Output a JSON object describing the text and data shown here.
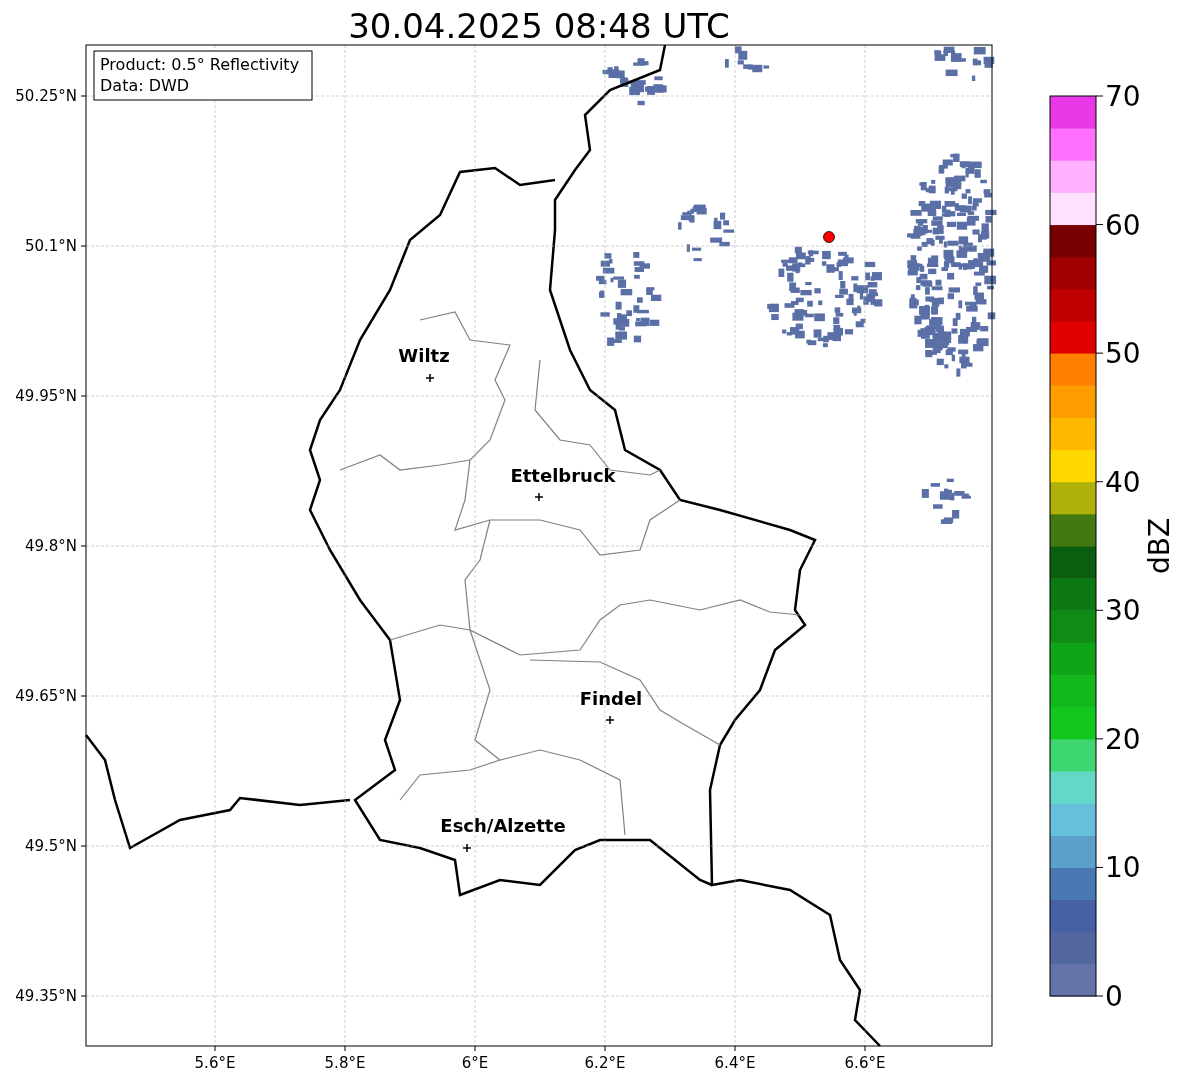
{
  "title": "30.04.2025 08:48 UTC",
  "info_box": [
    "Product: 0.5° Reflectivity",
    "Data: DWD"
  ],
  "map": {
    "lat_ticks": [
      "50.25°N",
      "50.1°N",
      "49.95°N",
      "49.8°N",
      "49.65°N",
      "49.5°N",
      "49.35°N"
    ],
    "lon_ticks": [
      "5.6°E",
      "5.8°E",
      "6°E",
      "6.2°E",
      "6.4°E",
      "6.6°E"
    ],
    "cities": [
      {
        "name": "Wiltz"
      },
      {
        "name": "Ettelbruck"
      },
      {
        "name": "Findel"
      },
      {
        "name": "Esch/Alzette"
      }
    ]
  },
  "colorbar": {
    "label": "dBZ",
    "ticks": [
      "70",
      "60",
      "50",
      "40",
      "30",
      "20",
      "10",
      "0"
    ]
  }
}
